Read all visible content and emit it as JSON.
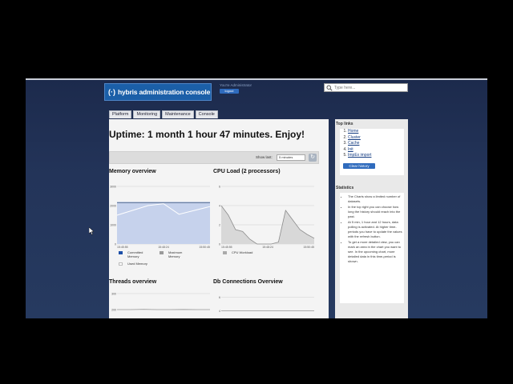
{
  "header": {
    "logo_mark": "(·)",
    "logo_text": "hybris administration console",
    "user_line": "You're Administrator",
    "logout_label": "logout",
    "search_placeholder": "Type here..."
  },
  "nav": {
    "tabs": [
      "Platform",
      "Monitoring",
      "Maintenance",
      "Console"
    ]
  },
  "main": {
    "uptime": "Uptime: 1 month 1 hour 47 minutes. Enjoy!",
    "show_last_label": "Show last:",
    "show_last_value": "5 minutes",
    "refresh_symbol": "↻"
  },
  "memory": {
    "title": "Memory overview",
    "legend": [
      "Committed Memory",
      "Maximum Memory",
      "Used Memory"
    ],
    "colors": {
      "committed": "#1c4fa8",
      "maximum": "#9a9a9a",
      "used": "#ffffff"
    }
  },
  "cpu": {
    "title": "CPU Load (2 processors)",
    "legend": [
      "CPU Workload"
    ]
  },
  "threads": {
    "title": "Threads overview"
  },
  "db": {
    "title": "Db Connections Overview"
  },
  "chart_data": [
    {
      "type": "area",
      "title": "Memory overview",
      "x_ticks": [
        "15:45:55",
        "15:48:24",
        "15:50:45"
      ],
      "y_ticks": [
        0,
        1000,
        2000,
        3000
      ],
      "ylim": [
        0,
        3000
      ],
      "series": [
        {
          "name": "Committed Memory",
          "values": [
            2150,
            2150,
            2150,
            2150,
            2150,
            2150,
            2150
          ]
        },
        {
          "name": "Maximum Memory",
          "values": [
            2150,
            2150,
            2150,
            2150,
            2150,
            2150,
            2150
          ]
        },
        {
          "name": "Used Memory",
          "values": [
            1500,
            1750,
            2000,
            2100,
            1550,
            1750,
            1950
          ]
        }
      ]
    },
    {
      "type": "area",
      "title": "CPU Load (2 processors)",
      "x_ticks": [
        "15:45:55",
        "15:48:24",
        "15:50:45"
      ],
      "y_ticks": [
        0,
        2,
        4,
        6
      ],
      "ylim": [
        0,
        6
      ],
      "series": [
        {
          "name": "CPU Workload",
          "values": [
            4,
            3,
            1.5,
            1.3,
            0.5,
            0,
            0,
            0,
            0.2,
            3.5,
            2.5,
            1.5,
            1.0,
            0.6
          ]
        }
      ]
    },
    {
      "type": "line",
      "title": "Threads overview",
      "y_ticks": [
        200,
        300
      ],
      "ylim": [
        150,
        320
      ],
      "series": [
        {
          "values": [
            200,
            200,
            202,
            200,
            200,
            201,
            200,
            200
          ]
        }
      ]
    },
    {
      "type": "line",
      "title": "Db Connections Overview",
      "y_ticks": [
        4,
        6
      ],
      "ylim": [
        3,
        7
      ],
      "series": [
        {
          "values": [
            4,
            4,
            4,
            4,
            4,
            4,
            4,
            4
          ]
        }
      ]
    }
  ],
  "sidebar": {
    "top_links_title": "Top links",
    "top_links": [
      "Home",
      "Cluster",
      "Cache",
      "Init",
      "ImpEx import"
    ],
    "clear_history_label": "Clear history",
    "statistics_title": "Statistics",
    "statistics": [
      "The Charts show a limited number of datasets.",
      "In the top right you can choose how long the history should reach into the past.",
      "At 5 min, 1 hour and 12 hours, data polling is activated. At higher time-periods you have to update the values with the refresh button.",
      "To get a more detailed view, you can mark an area in the chart you want to see. In the upcoming chart, more detailed data in this time-period is shown."
    ]
  }
}
